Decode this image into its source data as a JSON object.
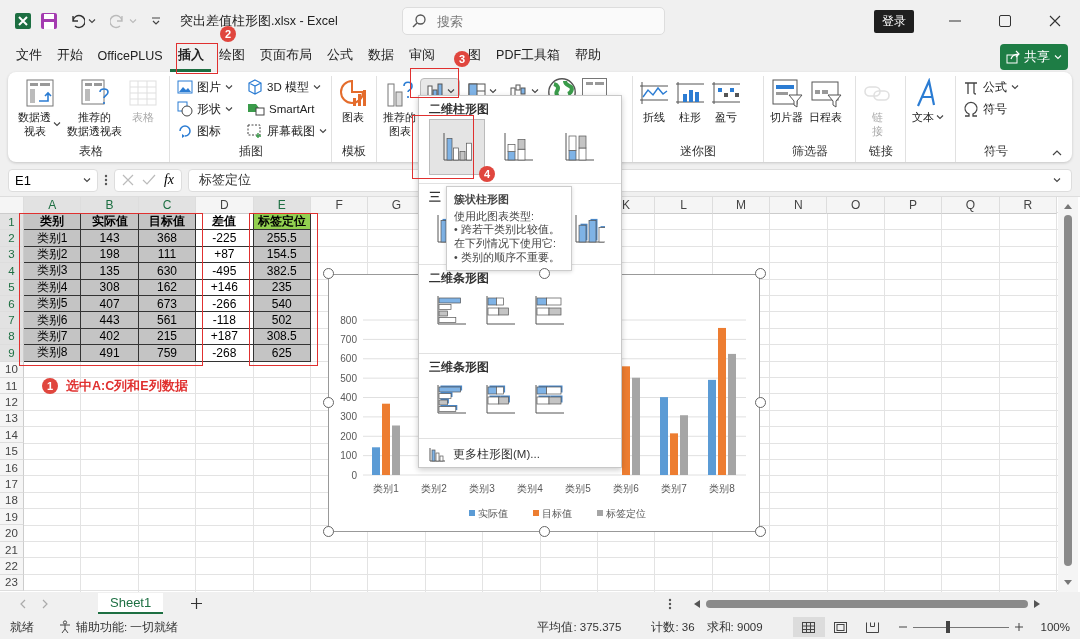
{
  "window": {
    "title": "突出差值柱形图.xlsx - Excel",
    "search_placeholder": "搜索",
    "sign_in": "登录"
  },
  "menu_tabs": [
    {
      "label": "文件",
      "selected": false
    },
    {
      "label": "开始",
      "selected": false
    },
    {
      "label": "OfficePLUS",
      "selected": false
    },
    {
      "label": "插入",
      "selected": true
    },
    {
      "label": "绘图",
      "selected": false
    },
    {
      "label": "页面布局",
      "selected": false
    },
    {
      "label": "公式",
      "selected": false
    },
    {
      "label": "数据",
      "selected": false
    },
    {
      "label": "审阅",
      "selected": false
    },
    {
      "label": "图",
      "selected": false,
      "kind": "covered"
    },
    {
      "label": "PDF工具箱",
      "selected": false
    },
    {
      "label": "帮助",
      "selected": false
    }
  ],
  "share_button": "共享",
  "ribbon_groups": [
    {
      "title": "表格",
      "items": [
        {
          "kind": "large",
          "lines": [
            "数据透",
            "视表"
          ],
          "dropdown": true,
          "disabled": false,
          "open": false
        },
        {
          "kind": "large",
          "lines": [
            "推荐的",
            "数据透视表"
          ],
          "dropdown": false,
          "disabled": false,
          "open": false
        },
        {
          "kind": "large",
          "label": "表格",
          "dropdown": false,
          "disabled": true,
          "open": false
        }
      ]
    },
    {
      "title": "插图",
      "items": [
        {
          "kind": "small",
          "label": "图片",
          "dropdown": true,
          "disabled": false,
          "open": false
        },
        {
          "kind": "small",
          "label": "形状",
          "dropdown": true,
          "disabled": false,
          "open": false
        },
        {
          "kind": "small",
          "label": "图标",
          "dropdown": false,
          "disabled": false,
          "open": false
        },
        {
          "kind": "small",
          "label": "3D 模型",
          "dropdown": true,
          "disabled": false,
          "open": false
        },
        {
          "kind": "small",
          "label": "SmartArt",
          "dropdown": false,
          "disabled": false,
          "open": false
        },
        {
          "kind": "small",
          "label": "屏幕截图",
          "dropdown": true,
          "disabled": false,
          "open": false
        }
      ]
    },
    {
      "title": "模板",
      "items": [
        {
          "kind": "large",
          "label": "图表",
          "dropdown": false,
          "disabled": false,
          "open": false
        }
      ]
    },
    {
      "items": [
        {
          "kind": "large",
          "lines": [
            "推荐的",
            "图表"
          ],
          "dropdown": false,
          "disabled": false,
          "open": false
        },
        {
          "kind": "icon",
          "dropdown": true,
          "disabled": false,
          "open": true
        },
        {
          "kind": "icon",
          "dropdown": true,
          "disabled": false,
          "open": false
        },
        {
          "kind": "icon",
          "dropdown": true,
          "disabled": false,
          "open": false
        },
        {
          "kind": "large",
          "dropdown": false,
          "disabled": false,
          "open": false
        },
        {
          "kind": "large",
          "dropdown": false,
          "disabled": false,
          "open": false
        }
      ]
    },
    {
      "title": "迷你图",
      "items": [
        {
          "kind": "large",
          "label": "折线",
          "dropdown": false,
          "disabled": false,
          "open": false
        },
        {
          "kind": "large",
          "label": "柱形",
          "dropdown": false,
          "disabled": false,
          "open": false
        },
        {
          "kind": "large",
          "label": "盈亏",
          "dropdown": false,
          "disabled": false,
          "open": false
        }
      ]
    },
    {
      "title": "筛选器",
      "items": [
        {
          "kind": "large",
          "label": "切片器",
          "dropdown": false,
          "disabled": false,
          "open": false
        },
        {
          "kind": "large",
          "label": "日程表",
          "dropdown": false,
          "disabled": false,
          "open": false
        }
      ]
    },
    {
      "title": "链接",
      "items": [
        {
          "kind": "large",
          "lines": [
            "链",
            "接"
          ],
          "dropdown": false,
          "disabled": true,
          "open": false
        }
      ]
    },
    {
      "items": [
        {
          "kind": "large",
          "label": "文本",
          "dropdown": true,
          "disabled": false,
          "open": false
        }
      ]
    },
    {
      "title": "符号",
      "items": [
        {
          "kind": "small",
          "label": "公式",
          "dropdown": true,
          "disabled": false,
          "open": false
        },
        {
          "kind": "small",
          "label": "符号",
          "dropdown": false,
          "disabled": false,
          "open": false
        }
      ]
    }
  ],
  "formula_bar": {
    "name_box": "E1",
    "function_label": "fx",
    "value": "标签定位"
  },
  "sheet": {
    "columns": [
      {
        "label": "A",
        "selected": true
      },
      {
        "label": "B",
        "selected": true
      },
      {
        "label": "C",
        "selected": true
      },
      {
        "label": "D",
        "selected": false
      },
      {
        "label": "E",
        "selected": true
      },
      {
        "label": "F",
        "selected": false
      },
      {
        "label": "G",
        "selected": false
      }
    ],
    "columns_after_menu": [
      {
        "label": "K",
        "selected": false
      },
      {
        "label": "L",
        "selected": false
      },
      {
        "label": "M",
        "selected": false
      },
      {
        "label": "N",
        "selected": false
      },
      {
        "label": "O",
        "selected": false
      },
      {
        "label": "P",
        "selected": false
      },
      {
        "label": "Q",
        "selected": false
      },
      {
        "label": "R",
        "selected": false
      }
    ],
    "rows": [
      {
        "number": "1",
        "selected": true,
        "cells": [
          {
            "text": "类别",
            "selected": true
          },
          {
            "text": "实际值",
            "selected": true
          },
          {
            "text": "目标值",
            "selected": true
          },
          {
            "text": "差值",
            "selected": false
          },
          {
            "text": "标签定位",
            "color": "#92d050"
          }
        ]
      },
      {
        "number": "2",
        "selected": true,
        "cells": [
          {
            "text": "类别1",
            "selected": true
          },
          {
            "text": "143",
            "selected": true
          },
          {
            "text": "368",
            "selected": true
          },
          {
            "text": "-225",
            "selected": false
          },
          {
            "text": "255.5",
            "selected": true
          }
        ]
      },
      {
        "number": "3",
        "selected": true,
        "cells": [
          {
            "text": "类别2",
            "selected": true
          },
          {
            "text": "198",
            "selected": true
          },
          {
            "text": "111",
            "selected": true
          },
          {
            "text": "+87",
            "selected": false
          },
          {
            "text": "154.5",
            "selected": true
          }
        ]
      },
      {
        "number": "4",
        "selected": true,
        "cells": [
          {
            "text": "类别3",
            "selected": true
          },
          {
            "text": "135",
            "selected": true
          },
          {
            "text": "630",
            "selected": true
          },
          {
            "text": "-495",
            "selected": false
          },
          {
            "text": "382.5",
            "selected": true
          }
        ]
      },
      {
        "number": "5",
        "selected": true,
        "cells": [
          {
            "text": "类别4",
            "selected": true
          },
          {
            "text": "308",
            "selected": true
          },
          {
            "text": "162",
            "selected": true
          },
          {
            "text": "+146",
            "selected": false
          },
          {
            "text": "235",
            "selected": true
          }
        ]
      },
      {
        "number": "6",
        "selected": true,
        "cells": [
          {
            "text": "类别5",
            "selected": true
          },
          {
            "text": "407",
            "selected": true
          },
          {
            "text": "673",
            "selected": true
          },
          {
            "text": "-266",
            "selected": false
          },
          {
            "text": "540",
            "selected": true
          }
        ]
      },
      {
        "number": "7",
        "selected": true,
        "cells": [
          {
            "text": "类别6",
            "selected": true
          },
          {
            "text": "443",
            "selected": true
          },
          {
            "text": "561",
            "selected": true
          },
          {
            "text": "-118",
            "selected": false
          },
          {
            "text": "502",
            "selected": true
          }
        ]
      },
      {
        "number": "8",
        "selected": true,
        "cells": [
          {
            "text": "类别7",
            "selected": true
          },
          {
            "text": "402",
            "selected": true
          },
          {
            "text": "215",
            "selected": true
          },
          {
            "text": "+187",
            "selected": false
          },
          {
            "text": "308.5",
            "selected": true
          }
        ]
      },
      {
        "number": "9",
        "selected": true,
        "cells": [
          {
            "text": "类别8",
            "selected": true
          },
          {
            "text": "491",
            "selected": true
          },
          {
            "text": "759",
            "selected": true
          },
          {
            "text": "-268",
            "selected": false
          },
          {
            "text": "625",
            "selected": true
          }
        ]
      },
      {
        "number": "10",
        "selected": false
      },
      {
        "number": "11",
        "selected": false
      },
      {
        "number": "12",
        "selected": false
      },
      {
        "number": "13",
        "selected": false
      },
      {
        "number": "14",
        "selected": false
      },
      {
        "number": "15",
        "selected": false
      },
      {
        "number": "16",
        "selected": false
      },
      {
        "number": "17",
        "selected": false
      },
      {
        "number": "18",
        "selected": false
      },
      {
        "number": "19",
        "selected": false
      },
      {
        "number": "20",
        "selected": false
      },
      {
        "number": "21",
        "selected": false
      },
      {
        "number": "22",
        "selected": false
      },
      {
        "number": "23",
        "selected": false
      }
    ]
  },
  "chart": {
    "chart_data": {
      "type": "bar",
      "categories": [
        "类别1",
        "类别2",
        "类别3",
        "类别4",
        "类别5",
        "类别6",
        "类别7",
        "类别8"
      ],
      "series": [
        {
          "name": "实际值",
          "color": "#5b9bd5",
          "values": [
            143,
            null,
            null,
            null,
            null,
            null,
            402,
            491
          ]
        },
        {
          "name": "目标值",
          "color": "#ed7d31",
          "values": [
            368,
            null,
            null,
            null,
            null,
            561,
            215,
            759
          ]
        },
        {
          "name": "标签定位",
          "color": "#a5a5a5",
          "values": [
            255.5,
            null,
            null,
            null,
            null,
            502,
            308.5,
            625
          ]
        }
      ],
      "ylim": [
        0,
        800
      ],
      "yticks": [
        0,
        100,
        200,
        300,
        400,
        500,
        600,
        700,
        800
      ],
      "grid": true,
      "legend": true
    }
  },
  "chart_menu": {
    "sections": [
      {
        "title": "二维柱形图",
        "kind": "column2d",
        "options": [
          {
            "kind": "clustered",
            "selected": true
          },
          {
            "kind": "stacked",
            "selected": false
          },
          {
            "kind": "percent",
            "selected": false
          }
        ]
      },
      {
        "title": "三",
        "kind": "column3d",
        "options": [
          {
            "kind": "clustered",
            "selected": false
          },
          {
            "kind": "cylinder",
            "selected": false
          }
        ]
      },
      {
        "title": "二维条形图",
        "kind": "bar2d",
        "options": [
          {
            "kind": "clustered",
            "selected": false
          },
          {
            "kind": "stacked",
            "selected": false
          },
          {
            "kind": "percent",
            "selected": false
          }
        ]
      },
      {
        "title": "三维条形图",
        "kind": "bar3d",
        "options": [
          {
            "kind": "clustered",
            "selected": false
          },
          {
            "kind": "stacked",
            "selected": false
          },
          {
            "kind": "percent",
            "selected": false
          }
        ]
      }
    ],
    "more_link": "更多柱形图(M)..."
  },
  "tooltip": {
    "title": "簇状柱形图",
    "lines": [
      "使用此图表类型:",
      "• 跨若干类别比较值。",
      "在下列情况下使用它:",
      "• 类别的顺序不重要。"
    ]
  },
  "annotations": {
    "badges": [
      "1",
      "2",
      "3",
      "4"
    ],
    "note": "选中A:C列和E列数据"
  },
  "sheet_tabs": [
    {
      "label": "Sheet1",
      "selected": true
    }
  ],
  "status_bar": {
    "ready": "就绪",
    "accessibility": "辅助功能: 一切就绪",
    "average": "平均值: 375.375",
    "count": "计数: 36",
    "sum": "求和: 9009",
    "view_buttons": [
      {
        "selected": true
      },
      {
        "selected": false
      },
      {
        "selected": false
      }
    ],
    "zoom_slider": {
      "level": 0.37
    },
    "zoom": "100%"
  }
}
